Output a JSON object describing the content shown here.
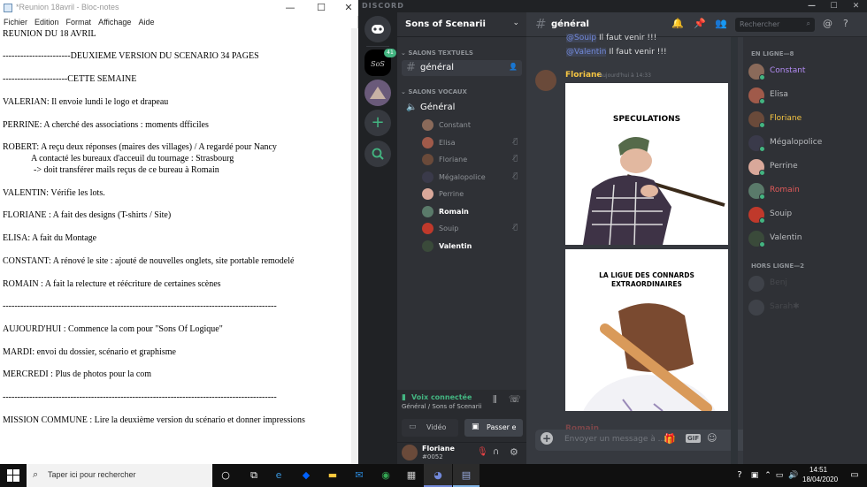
{
  "notepad": {
    "title": "*Reunion 18avril - Bloc-notes",
    "menu": [
      "Fichier",
      "Edition",
      "Format",
      "Affichage",
      "Aide"
    ],
    "lines": [
      "REUNION DU 18 AVRIL",
      "-----------------------DEUXIEME VERSION DU SCENARIO 34 PAGES",
      "----------------------CETTE SEMAINE",
      "VALERIAN: Il envoie lundi le logo et drapeau",
      "PERRINE: A cherché des associations : moments dfficiles",
      "ROBERT: A reçu deux réponses (maires des villages) / A regardé pour Nancy",
      "             A contacté les bureaux d'acceuil du tournage : Strasbourg",
      "              -> doit transférer mails reçus de ce bureau à Romain",
      "VALENTIN: Vérifie les lots.",
      "FLORIANE : A fait des designs (T-shirts / Site)",
      "ELISA: A fait du Montage",
      "CONSTANT: A rénové le site : ajouté de nouvelles onglets, site portable remodelé",
      "ROMAIN : A fait la relecture et réécriture de certaines scènes",
      "---------------------------------------------------------------------------------------------",
      "AUJOURD'HUI : Commence la com pour \"Sons Of Logique\"",
      "MARDI: envoi du dossier, scénario et graphisme",
      "MERCREDI : Plus de photos pour la com",
      "---------------------------------------------------------------------------------------------",
      "MISSION COMMUNE : Lire la deuxième version du scénario et donner impressions"
    ]
  },
  "discord": {
    "app_label": "DISCORD",
    "guild_badge": "41",
    "server_name": "Sons of Scenarii",
    "text_category": "SALONS TEXTUELS",
    "text_channel": "général",
    "voice_category": "SALONS VOCAUX",
    "voice_channel": "Général",
    "voice_users": [
      {
        "name": "Constant",
        "muted": false,
        "color": "#8a6a5a"
      },
      {
        "name": "Elisa",
        "muted": true,
        "color": "#a05a4a"
      },
      {
        "name": "Floriane",
        "muted": true,
        "color": "#6a4a3a"
      },
      {
        "name": "Mégalopolice",
        "muted": true,
        "color": "#3a3a4a"
      },
      {
        "name": "Perrine",
        "muted": false,
        "color": "#d9a89a"
      },
      {
        "name": "Romain",
        "muted": false,
        "color": "#5a7a6a",
        "bold": true
      },
      {
        "name": "Souip",
        "muted": true,
        "color": "#c0392b"
      },
      {
        "name": "Valentin",
        "muted": false,
        "color": "#3a4a3a",
        "bold": true
      }
    ],
    "voice_status": "Voix connectée",
    "voice_location": "Général / Sons of Scenarii",
    "video_label": "Vidéo",
    "screen_label": "Passer e",
    "user": {
      "name": "Floriane",
      "tag": "#0052"
    },
    "chat_header": "général",
    "search_placeholder": "Rechercher",
    "prev_lines": [
      {
        "mention": "@Souip",
        "text": " Il faut venir !!!"
      },
      {
        "mention": "@Valentin",
        "text": " Il faut venir !!!"
      }
    ],
    "message": {
      "author": "Floriane",
      "time": "Aujourd'hui à 14:33"
    },
    "image1_caption": "SPECULATIONS",
    "image2_caption_1": "LA LIGUE DES CONNARDS",
    "image2_caption_2": "EXTRAORDINAIRES",
    "next_author": "Romain",
    "compose_placeholder": "Envoyer un message à ...",
    "gif_label": "GIF",
    "online_header": "EN LIGNE—8",
    "offline_header": "HORS LIGNE—2",
    "members_online": [
      {
        "name": "Constant",
        "color": "#b38cf5",
        "av": "#8a6a5a"
      },
      {
        "name": "Elisa",
        "color": "#b9bbbe",
        "av": "#a05a4a"
      },
      {
        "name": "Floriane",
        "color": "#f5c542",
        "av": "#6a4a3a"
      },
      {
        "name": "Mégalopolice",
        "color": "#b9bbbe",
        "av": "#3a3a4a"
      },
      {
        "name": "Perrine",
        "color": "#b9bbbe",
        "av": "#d9a89a"
      },
      {
        "name": "Romain",
        "color": "#e05a5a",
        "av": "#5a7a6a"
      },
      {
        "name": "Souip",
        "color": "#b9bbbe",
        "av": "#c0392b"
      },
      {
        "name": "Valentin",
        "color": "#b9bbbe",
        "av": "#3a4a3a"
      }
    ],
    "members_offline": [
      {
        "name": "Benj",
        "color": "#5c5e62",
        "av": "#4f545c"
      },
      {
        "name": "Sarah✱",
        "color": "#5c5e62",
        "av": "#4f545c"
      }
    ]
  },
  "taskbar": {
    "search_placeholder": "Taper ici pour rechercher",
    "time": "14:51",
    "date": "18/04/2020"
  }
}
